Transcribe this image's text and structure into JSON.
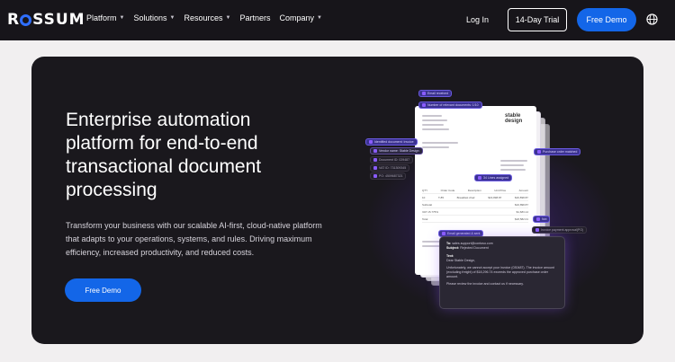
{
  "nav": {
    "logo": "ROSSUM",
    "menu": [
      {
        "label": "Platform",
        "dropdown": true
      },
      {
        "label": "Solutions",
        "dropdown": true
      },
      {
        "label": "Resources",
        "dropdown": true
      },
      {
        "label": "Partners",
        "dropdown": false
      },
      {
        "label": "Company",
        "dropdown": true
      }
    ],
    "login": "Log In",
    "trial": "14-Day Trial",
    "demo": "Free Demo",
    "globe_icon": "globe-icon"
  },
  "hero": {
    "title": "Enterprise automation platform for end-to-end transactional document processing",
    "description": "Transform your business with our scalable AI-first, cloud-native platform that adapts to your operations, systems, and rules. Driving maximum efficiency, increased productivity, and reduced costs.",
    "cta": "Free Demo"
  },
  "illustration": {
    "chips": {
      "email_received": "Email received",
      "doc_number": "Number of relevant documents: 1/10",
      "identified": "Identified document: Invoice",
      "vendor": "Vendor name: Stable Design",
      "document_id": "Document ID: 029487",
      "vat": "VAT ID: 731309345",
      "po_match": "PO: 4509687321",
      "purchase_order": "Purchase order matched",
      "line_items": "34 Lines assigned",
      "not": "Not",
      "email_generated": "Email generated & sent",
      "invoice_approval": "Invoice payment approval(PO)"
    },
    "doc": {
      "brand_line1": "stable",
      "brand_line2": "design",
      "table_header": [
        "QTY",
        "Order Code",
        "Description",
        "Unit Price",
        "Amount"
      ],
      "table_row": [
        "10",
        "T-85",
        "Breakfast chair",
        "$16,898.87",
        "$16,898.87"
      ],
      "subtotal": [
        "",
        "",
        "",
        "Subtotal",
        "$16,898.87"
      ],
      "vat": [
        "",
        "",
        "",
        "VAT 15.775%",
        "$1,683.14"
      ],
      "total": [
        "",
        "",
        "",
        "Total",
        "$18,582.01"
      ]
    },
    "email": {
      "to_label": "To:",
      "to_value": "sales.support@contoso.com",
      "subject_label": "Subject:",
      "subject_value": "Rejected Document",
      "text_label": "Text:",
      "greeting": "Dear Stable Design,",
      "body": "Unfortunately, we cannot accept your invoice (030487). The invoice amount (excluding freight) of $18,296.74 exceeds the approved purchase order amount.",
      "closing": "Please review the invoice and contact us if necessary."
    }
  }
}
